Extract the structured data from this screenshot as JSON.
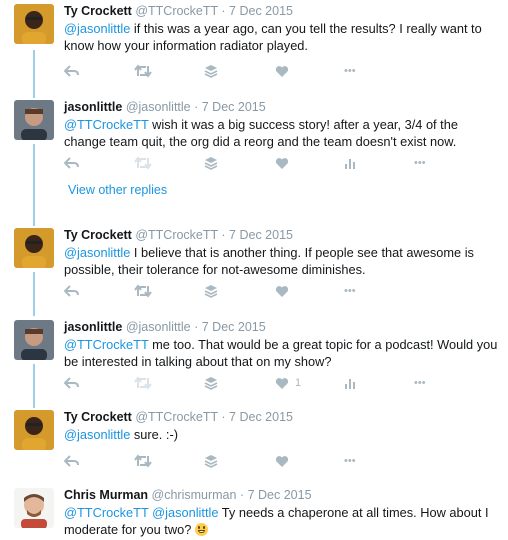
{
  "tweets": [
    {
      "name": "Ty Crockett",
      "handle": "@TTCrockeTT",
      "date": "· 7 Dec 2015",
      "mention": "@jasonlittle",
      "text": " if this was a year ago, can you tell the results? I really want to know how your information radiator played."
    },
    {
      "name": "jasonlittle",
      "handle": "@jasonlittle",
      "date": "· 7 Dec 2015",
      "mention": "@TTCrockeTT",
      "text": " wish it was a big success story! after a year, 3/4 of the change team quit, the org did a reorg and the team doesn't exist now."
    },
    {
      "name": "Ty Crockett",
      "handle": "@TTCrockeTT",
      "date": "· 7 Dec 2015",
      "mention": "@jasonlittle",
      "text": " I believe that is another thing. If people see that awesome is possible, their tolerance for not-awesome diminishes."
    },
    {
      "name": "jasonlittle",
      "handle": "@jasonlittle",
      "date": "· 7 Dec 2015",
      "mention": "@TTCrockeTT",
      "text": " me too. That would be a great topic for a podcast! Would you be interested in talking about that on my show?",
      "like_count": "1"
    },
    {
      "name": "Ty Crockett",
      "handle": "@TTCrockeTT",
      "date": "· 7 Dec 2015",
      "mention": "@jasonlittle",
      "text": " sure. :-)"
    },
    {
      "name": "Chris Murman",
      "handle": "@chrismurman",
      "date": "· 7 Dec 2015",
      "mention": "@TTCrockeTT @jasonlittle",
      "text": " Ty needs a chaperone at all times. How about I moderate for you two?"
    }
  ],
  "view_other_replies": "View other replies",
  "more_label": "•••",
  "colors": {
    "link": "#1b95e0",
    "icon": "#aab8c2",
    "thread": "#9ecfe6"
  }
}
